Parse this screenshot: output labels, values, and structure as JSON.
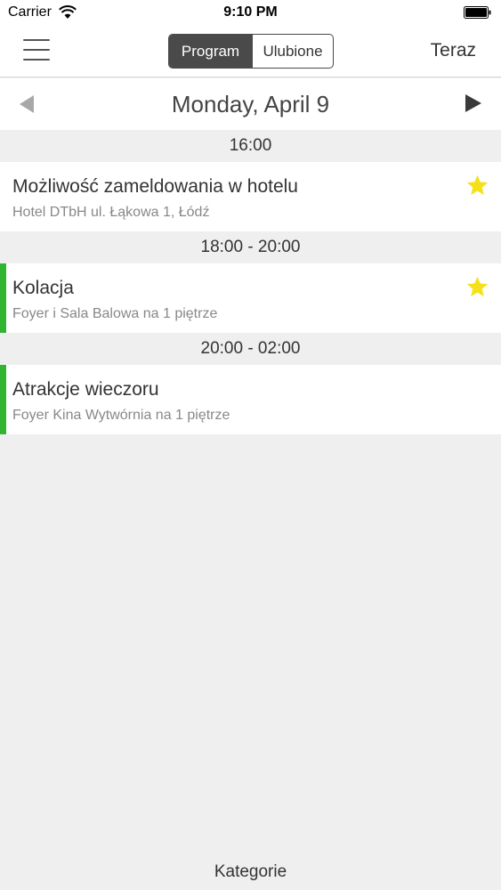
{
  "status": {
    "carrier": "Carrier",
    "time": "9:10 PM"
  },
  "nav": {
    "segments": [
      "Program",
      "Ulubione"
    ],
    "now_label": "Teraz"
  },
  "date": {
    "label": "Monday, April 9"
  },
  "schedule": [
    {
      "time": "16:00",
      "event": {
        "title": "Możliwość zameldowania w hotelu",
        "location": "Hotel DTbH ul. Łąkowa 1, Łódź",
        "favorite": true,
        "accent": false
      }
    },
    {
      "time": "18:00 - 20:00",
      "event": {
        "title": "Kolacja",
        "location": "Foyer i Sala Balowa na 1 piętrze",
        "favorite": true,
        "accent": true
      }
    },
    {
      "time": "20:00 - 02:00",
      "event": {
        "title": "Atrakcje wieczoru",
        "location": "Foyer Kina Wytwórnia na 1 piętrze",
        "favorite": false,
        "accent": true
      }
    }
  ],
  "colors": {
    "accent": "#2fb52f",
    "star": "#f5e11a",
    "segment_active": "#4a4a4a"
  },
  "footer": {
    "label": "Kategorie"
  }
}
